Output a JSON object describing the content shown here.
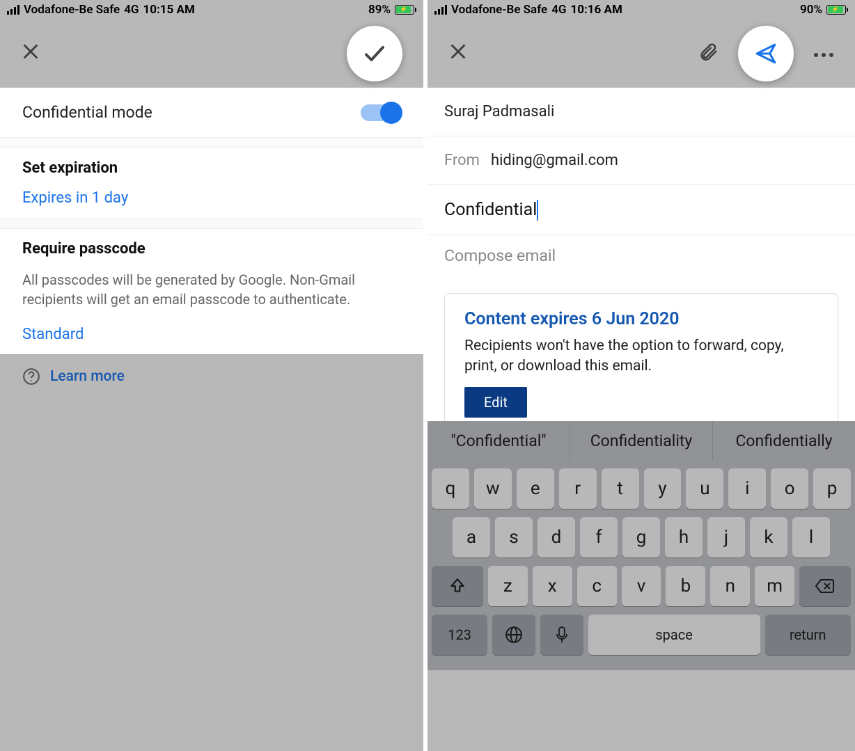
{
  "left": {
    "status": {
      "carrier": "Vodafone-Be Safe",
      "network": "4G",
      "time": "10:15 AM",
      "battery_pct": "89%"
    },
    "confidential_mode_label": "Confidential mode",
    "set_expiration_title": "Set expiration",
    "expiration_value": "Expires in 1 day",
    "passcode_title": "Require passcode",
    "passcode_desc": "All passcodes will be generated by Google. Non-Gmail recipients will get an email passcode to authenticate.",
    "passcode_value": "Standard",
    "learn_more": "Learn more"
  },
  "right": {
    "status": {
      "carrier": "Vodafone-Be Safe",
      "network": "4G",
      "time": "10:16 AM",
      "battery_pct": "90%"
    },
    "to_name": "Suraj Padmasali",
    "from_label": "From",
    "from_email": "hiding@gmail.com",
    "subject": "Confidential",
    "compose_placeholder": "Compose email",
    "card_title": "Content expires 6 Jun 2020",
    "card_desc": "Recipients won't have the option to forward, copy, print, or download this email.",
    "edit_label": "Edit",
    "suggestions": [
      "\"Confidential\"",
      "Confidentiality",
      "Confidentially"
    ],
    "keys": {
      "row1": [
        "q",
        "w",
        "e",
        "r",
        "t",
        "y",
        "u",
        "i",
        "o",
        "p"
      ],
      "row2": [
        "a",
        "s",
        "d",
        "f",
        "g",
        "h",
        "j",
        "k",
        "l"
      ],
      "row3": [
        "z",
        "x",
        "c",
        "v",
        "b",
        "n",
        "m"
      ],
      "num": "123",
      "space": "space",
      "return": "return"
    }
  }
}
